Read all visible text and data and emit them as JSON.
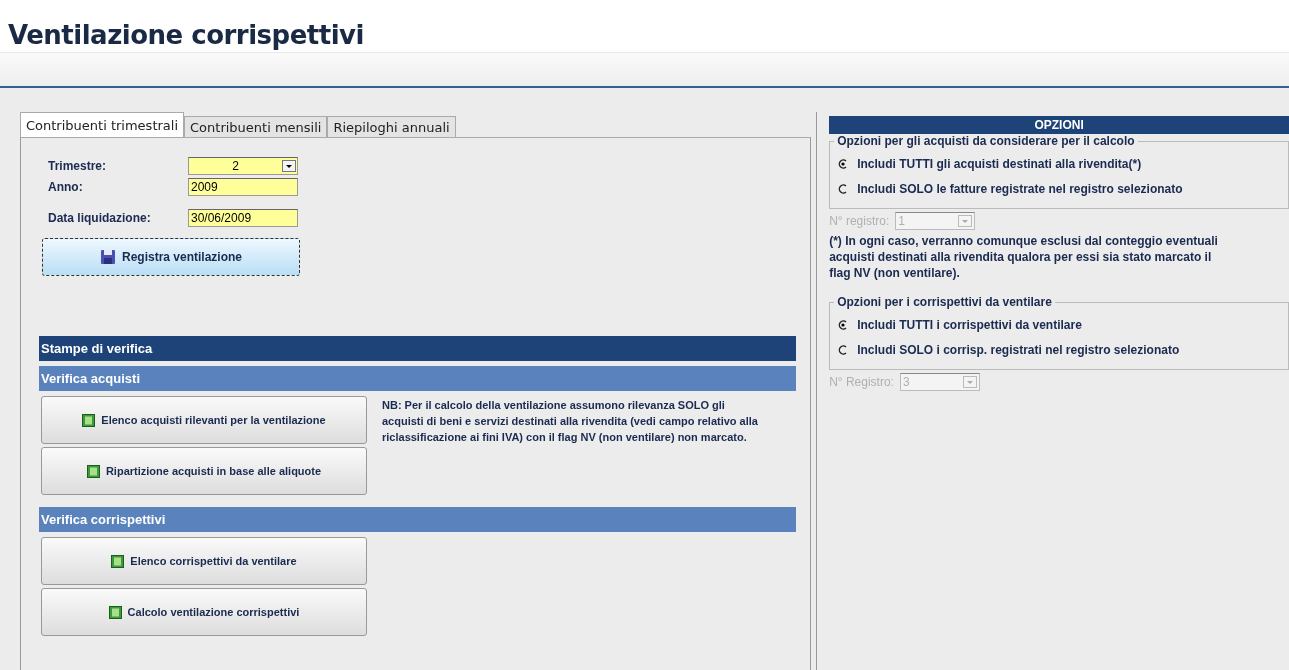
{
  "page_title": "Ventilazione corrispettivi",
  "tabs": [
    {
      "label": "Contribuenti trimestrali",
      "selected": true
    },
    {
      "label": "Contribuenti mensili",
      "selected": false
    },
    {
      "label": "Riepiloghi annuali",
      "selected": false
    }
  ],
  "fields": [
    {
      "label": "Trimestre:",
      "value": "2",
      "kind": "combo"
    },
    {
      "label": "Anno:",
      "value": "2009",
      "kind": "text"
    },
    {
      "label": "Data liquidazione:",
      "value": "30/06/2009",
      "kind": "text"
    }
  ],
  "save_button": "Registra ventilazione",
  "print_section": {
    "title": "Stampe di verifica",
    "groups": [
      {
        "title": "Verifica acquisti",
        "buttons": [
          "Elenco acquisti rilevanti per la ventilazione",
          "Ripartizione acquisti in base alle aliquote"
        ],
        "note": "NB: Per il calcolo della ventilazione assumono rilevanza SOLO gli acquisti di beni e servizi destinati alla rivendita (vedi campo relativo alla riclassificazione ai fini IVA)  con il flag NV (non ventilare) non marcato."
      },
      {
        "title": "Verifica corrispettivi",
        "buttons": [
          "Elenco corrispettivi da ventilare",
          "Calcolo ventilazione corrispettivi"
        ]
      }
    ]
  },
  "options": {
    "header": "OPZIONI",
    "groups": [
      {
        "legend": "Opzioni per gli acquisti da considerare per il calcolo",
        "choices": [
          {
            "label": "Includi TUTTI gli acquisti destinati alla rivendita(*)",
            "selected": true
          },
          {
            "label": "Includi SOLO le fatture registrate nel registro selezionato",
            "selected": false
          }
        ],
        "register": {
          "label": "N° registro:",
          "value": "1",
          "disabled": true
        },
        "footnote": "(*) In ogni caso, verranno comunque esclusi dal conteggio eventuali acquisti destinati alla rivendita qualora per essi sia stato marcato il flag NV (non ventilare)."
      },
      {
        "legend": "Opzioni per i corrispettivi da ventilare",
        "choices": [
          {
            "label": "Includi TUTTI i corrispettivi da ventilare",
            "selected": true
          },
          {
            "label": "Includi SOLO i corrisp. registrati nel registro selezionato",
            "selected": false
          }
        ],
        "register": {
          "label": "N° Registro:",
          "value": "3",
          "disabled": true
        }
      }
    ]
  }
}
